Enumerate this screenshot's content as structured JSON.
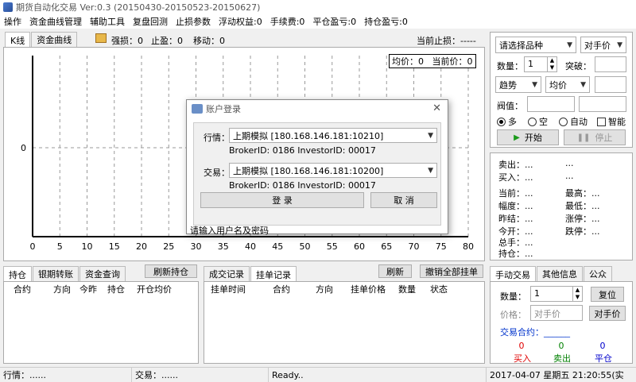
{
  "window_title": "期货自动化交易 Ver:0.3 (20150430-20150523-20150627)",
  "menu": [
    "操作",
    "资金曲线管理",
    "辅助工具",
    "复盘回测",
    "止损参数",
    "浮动权益:0",
    "手续费:0",
    "平仓盈亏:0",
    "持仓盈亏:0"
  ],
  "chart_tabs": [
    "K线",
    "资金曲线"
  ],
  "chart_header": {
    "stop_loss": "强损：0",
    "take_profit": "止盈：0",
    "move": "移动：0",
    "current_stop": "当前止损：-----"
  },
  "chart_overlay": "均价：0   当前价：0",
  "chart_data": {
    "type": "line",
    "x_ticks": [
      "0",
      "5",
      "10",
      "15",
      "20",
      "25",
      "30",
      "35",
      "40",
      "45",
      "50",
      "55",
      "60",
      "65",
      "70",
      "75",
      "80"
    ],
    "y_ticks": [
      "0"
    ],
    "series": []
  },
  "right_panel": {
    "symbol_select": "请选择品种",
    "price_select": "对手价",
    "qty_label": "数量：",
    "qty_value": "1",
    "breakout_label": "突破：",
    "trend_select": "趋势",
    "avg_select": "均价",
    "threshold_label": "阀值：",
    "radio_long": "多",
    "radio_short": "空",
    "radio_auto": "自动",
    "smart_label": "智能",
    "start_btn": "开始",
    "stop_btn": "停止"
  },
  "quote": {
    "sell": "卖出：...",
    "buy": "买入：...",
    "sell_v": "...",
    "buy_v": "...",
    "current": "当前：...",
    "high": "最高：...",
    "amplitude": "幅度：...",
    "low": "最低：...",
    "prev_settle": "昨结：...",
    "limit_up": "涨停：...",
    "today_open": "今开：...",
    "limit_down": "跌停：...",
    "total_pnl": "总手：...",
    "position": "持仓：..."
  },
  "left_tabs": [
    "持仓",
    "银期转账",
    "资金查询"
  ],
  "refresh_pos_btn": "刷新持仓",
  "pos_columns": [
    "合约",
    "方向",
    "今昨",
    "持仓",
    "开仓均价"
  ],
  "order_tabs": [
    "成交记录",
    "挂单记录"
  ],
  "refresh_btn": "刷新",
  "cancel_all_btn": "撤销全部挂单",
  "order_columns": [
    "挂单时间",
    "合约",
    "方向",
    "挂单价格",
    "数量",
    "状态"
  ],
  "manual_tabs": [
    "手动交易",
    "其他信息",
    "公众"
  ],
  "manual": {
    "qty_label": "数量：",
    "qty_value": "1",
    "reset_btn": "复位",
    "price_label": "价格：",
    "price_placeholder": "对手价",
    "opp_btn": "对手价",
    "contract_label": "交易合约：______",
    "buy_count": "0",
    "buy_label": "买入",
    "sell_count": "0",
    "sell_label": "卖出",
    "close_count": "0",
    "close_label": "平仓"
  },
  "dialog": {
    "title": "账户登录",
    "quote_label": "行情：",
    "quote_server": "上期模拟 [180.168.146.181:10210]",
    "quote_ids": "BrokerID: 0186  InvestorID: 00017",
    "trade_label": "交易：",
    "trade_server": "上期模拟 [180.168.146.181:10200]",
    "trade_ids": "BrokerID: 0186  InvestorID: 00017",
    "login_btn": "登 录",
    "cancel_btn": "取 消",
    "status": "请输入用户名及密码"
  },
  "status": {
    "quote": "行情：......",
    "trade": "交易：......",
    "ready": "Ready..",
    "datetime": "2017-04-07  星期五  21:20:55(实"
  },
  "colors": {
    "buy": "#e00000",
    "sell": "#008000",
    "close": "#0000cc",
    "link": "#0033cc"
  }
}
